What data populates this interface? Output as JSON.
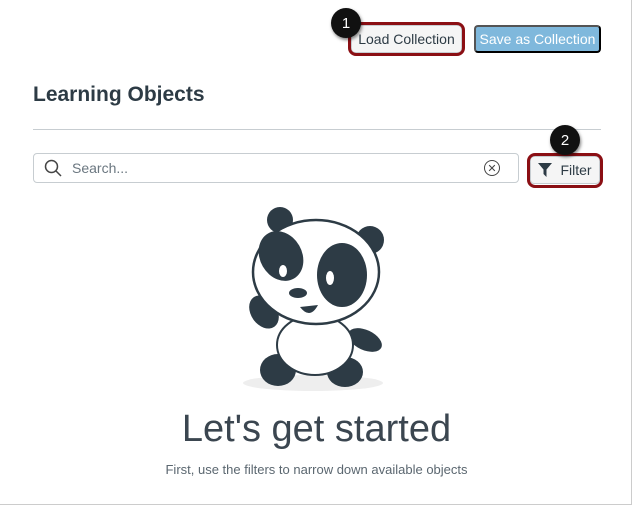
{
  "header": {
    "load_label": "Load Collection",
    "save_label": "Save as Collection"
  },
  "callouts": [
    "1",
    "2"
  ],
  "page_title": "Learning Objects",
  "search": {
    "placeholder": "Search...",
    "value": ""
  },
  "filter_label": "Filter",
  "empty_state": {
    "title": "Let's get started",
    "subtitle": "First, use the filters to narrow down available objects"
  },
  "colors": {
    "primary": "#7fb8dc",
    "highlight": "#8b0f14"
  }
}
